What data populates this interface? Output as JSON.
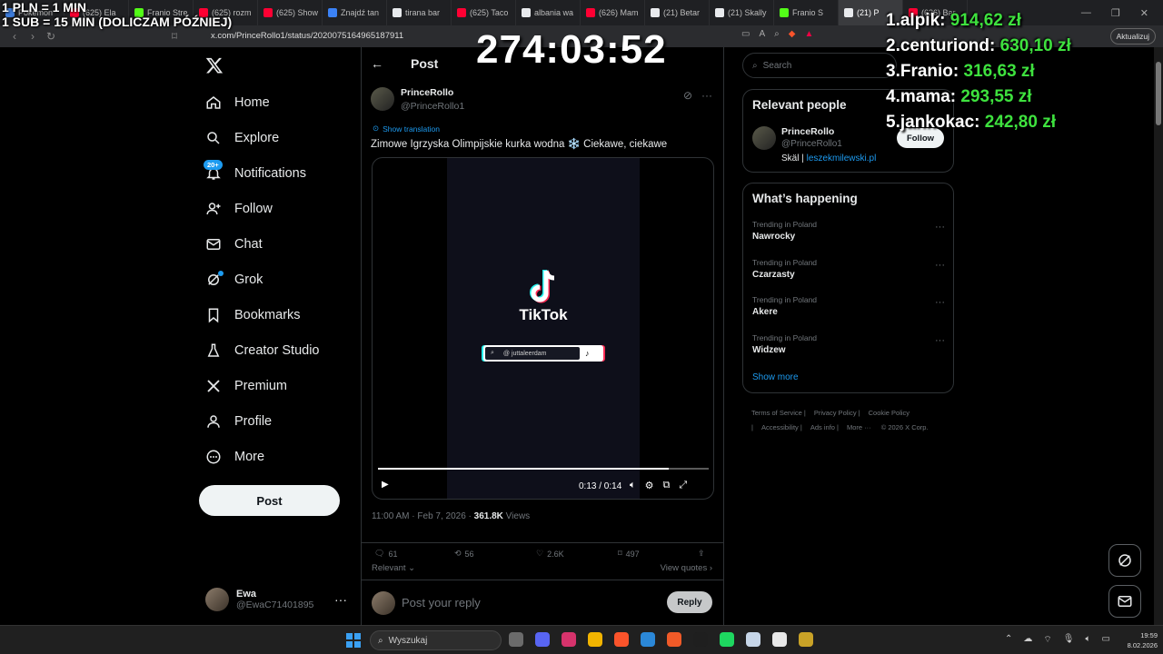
{
  "browser": {
    "tabs": [
      {
        "label": "Pokemon",
        "color": "#3d7bd9",
        "active": false
      },
      {
        "label": "(625) Ela",
        "color": "#ff0033",
        "active": false
      },
      {
        "label": "Franio Stre",
        "color": "#53fc18",
        "active": false
      },
      {
        "label": "(625) rozm",
        "color": "#ff0033",
        "active": false
      },
      {
        "label": "(625) Show",
        "color": "#ff0033",
        "active": false
      },
      {
        "label": "Znajdź tan",
        "color": "#3b82f6",
        "active": false
      },
      {
        "label": "tirana bar",
        "color": "#e8eaed",
        "active": false
      },
      {
        "label": "(625) Taco",
        "color": "#ff0033",
        "active": false
      },
      {
        "label": "albania wa",
        "color": "#e8eaed",
        "active": false
      },
      {
        "label": "(626) Mam",
        "color": "#ff0033",
        "active": false
      },
      {
        "label": "(21) Betar",
        "color": "#e8eaed",
        "active": false
      },
      {
        "label": "(21) Skally",
        "color": "#e8eaed",
        "active": false
      },
      {
        "label": "Franio S",
        "color": "#53fc18",
        "active": false
      },
      {
        "label": "(21) P",
        "color": "#e8eaed",
        "active": true
      },
      {
        "label": "(626) Bar",
        "color": "#ff0033",
        "active": false
      }
    ],
    "url": "x.com/PrinceRollo1/status/2020075164965187911",
    "update_label": "Aktualizuj"
  },
  "overlay": {
    "rate_line1": "1 PLN = 1 MIN",
    "rate_line2": "1 SUB = 15 MIN (DOLICZAM PÓŹNIEJ)",
    "timer": "274:03:52",
    "leaderboard": [
      {
        "rank": "1.",
        "name": "alpik:",
        "amount": "914,62 zł"
      },
      {
        "rank": "2.",
        "name": "centuriond:",
        "amount": "630,10 zł"
      },
      {
        "rank": "3.",
        "name": "Franio:",
        "amount": "316,63 zł"
      },
      {
        "rank": "4.",
        "name": "mama:",
        "amount": "293,55 zł"
      },
      {
        "rank": "5.",
        "name": "jankokac:",
        "amount": "242,80 zł"
      }
    ]
  },
  "nav": {
    "items": [
      {
        "label": "Home",
        "icon": "home-icon"
      },
      {
        "label": "Explore",
        "icon": "search-icon"
      },
      {
        "label": "Notifications",
        "icon": "bell-icon"
      },
      {
        "label": "Follow",
        "icon": "person-add-icon"
      },
      {
        "label": "Chat",
        "icon": "mail-icon"
      },
      {
        "label": "Grok",
        "icon": "grok-icon"
      },
      {
        "label": "Bookmarks",
        "icon": "bookmark-icon"
      },
      {
        "label": "Creator Studio",
        "icon": "flask-icon"
      },
      {
        "label": "Premium",
        "icon": "x-icon"
      },
      {
        "label": "Profile",
        "icon": "person-icon"
      },
      {
        "label": "More",
        "icon": "more-circle-icon"
      }
    ],
    "notifications_badge": "20+",
    "post_label": "Post",
    "account": {
      "name": "Ewa",
      "handle": "@EwaC71401895",
      "more": "···"
    }
  },
  "post": {
    "header": "Post",
    "author_name": "PrinceRollo",
    "author_handle": "@PrinceRollo1",
    "show_translation": "Show translation",
    "text": "Zimowe Igrzyska Olimpijskie kurka wodna ❄️ Ciekawe, ciekawe",
    "video": {
      "brand": "TikTok",
      "search_text": "@ juttaleerdam",
      "time": "0:13 / 0:14",
      "progress": 0.878
    },
    "timestamp": "11:00 AM · Feb 7, 2026 · ",
    "views_count": "361.8K",
    "views_label": " Views",
    "replies": "61",
    "reposts": "56",
    "likes": "2.6K",
    "bookmarks": "497",
    "sort_label": "Relevant ⌄",
    "view_quotes": "View quotes ›",
    "reply_placeholder": "Post your reply",
    "reply_button": "Reply"
  },
  "sidebar": {
    "search_placeholder": "Search",
    "relevant_title": "Relevant people",
    "person_name": "PrinceRollo",
    "person_handle": "@PrinceRollo1",
    "person_bio_prefix": "Skäl | ",
    "person_bio_link": "leszekmilewski.pl",
    "follow_label": "Follow",
    "happening_title": "What’s happening",
    "trends": [
      {
        "context": "Trending in Poland",
        "name": "Nawrocky"
      },
      {
        "context": "Trending in Poland",
        "name": "Czarzasty"
      },
      {
        "context": "Trending in Poland",
        "name": "Akere"
      },
      {
        "context": "Trending in Poland",
        "name": "Widzew"
      }
    ],
    "show_more": "Show more",
    "footer": [
      "Terms of Service |",
      "Privacy Policy |",
      "Cookie Policy |",
      "Accessibility |",
      "Ads info |",
      "More ··· ",
      "© 2026 X Corp."
    ]
  },
  "taskbar": {
    "search_label": "Wyszukaj",
    "time": "19:59",
    "date": "8.02.2026",
    "apps": [
      "#6b6b6b",
      "#5865f2",
      "#d6336c",
      "#f2b400",
      "#fb542b",
      "#2b88d8",
      "#f05a28",
      "#1f1f1f",
      "#1ed760",
      "#c7d6e8",
      "#e8e8e8",
      "#c9a227"
    ]
  },
  "colors": {
    "accent": "#1d9bf0",
    "leaderboard_amount": "#3ee13e"
  }
}
